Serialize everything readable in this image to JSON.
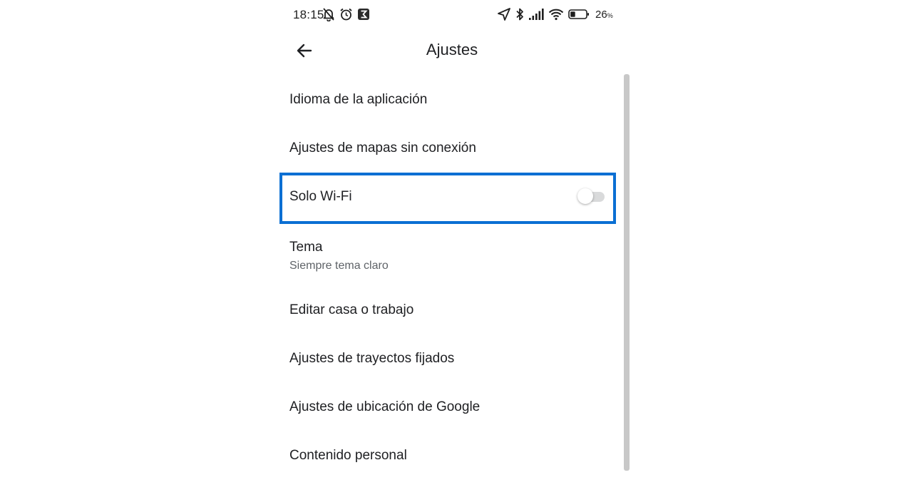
{
  "status_bar": {
    "time": "18:15",
    "battery_percent": "26",
    "battery_percent_sign": "%",
    "icons_left": [
      "bell-muted-icon",
      "alarm-clock-icon",
      "app-notification-icon"
    ],
    "icons_right": [
      "location-arrow-icon",
      "bluetooth-icon",
      "signal-bars-icon",
      "wifi-icon",
      "battery-icon"
    ]
  },
  "header": {
    "title": "Ajustes",
    "back_icon": "arrow-left-icon"
  },
  "settings": {
    "items": [
      {
        "label": "Idioma de la aplicación"
      },
      {
        "label": "Ajustes de mapas sin conexión"
      },
      {
        "label": "Solo Wi-Fi",
        "toggle_on": false,
        "highlighted": true
      },
      {
        "label": "Tema",
        "sublabel": "Siempre tema claro"
      },
      {
        "label": "Editar casa o trabajo"
      },
      {
        "label": "Ajustes de trayectos fijados"
      },
      {
        "label": "Ajustes de ubicación de Google"
      },
      {
        "label": "Contenido personal"
      }
    ]
  },
  "colors": {
    "highlight_border": "#0a6fd3",
    "text_primary": "#202124",
    "text_secondary": "#5f6368",
    "toggle_track_off": "#d9dadb",
    "scrollbar": "#c8c8c8"
  }
}
